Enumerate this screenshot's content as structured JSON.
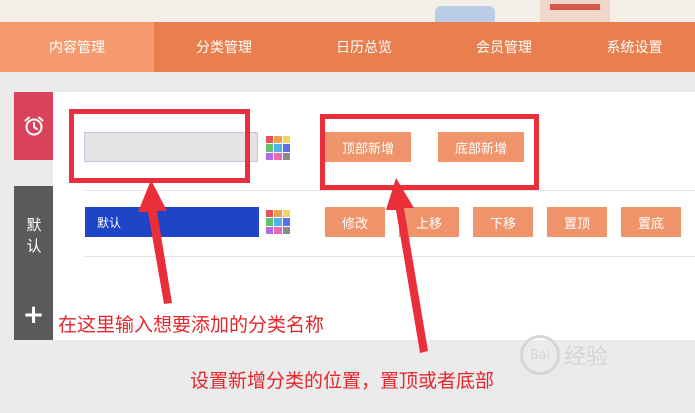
{
  "nav": {
    "tabs": [
      {
        "label": "内容管理",
        "active": true
      },
      {
        "label": "分类管理",
        "active": false
      },
      {
        "label": "日历总览",
        "active": false
      },
      {
        "label": "会员管理",
        "active": false
      },
      {
        "label": "系统设置",
        "active": false
      }
    ]
  },
  "sidebar": {
    "default_label": "默认",
    "add_symbol": "+"
  },
  "form": {
    "name_input_value": "",
    "add_top_label": "顶部新增",
    "add_bottom_label": "底部新增"
  },
  "category_row": {
    "name": "默认",
    "color": "#1e44c8",
    "actions": [
      "修改",
      "上移",
      "下移",
      "置顶",
      "置底"
    ]
  },
  "palette_colors": [
    "#e8505b",
    "#f0a04b",
    "#f6d35c",
    "#60c26a",
    "#4fb3e8",
    "#5c6ee8",
    "#b26ae8",
    "#e86ab2",
    "#8a8a8a"
  ],
  "annotations": {
    "input_note": "在这里输入想要添加的分类名称",
    "position_note": "设置新增分类的位置，置顶或者底部"
  },
  "watermark": {
    "text": "经验"
  },
  "colors": {
    "accent": "#e97f4f",
    "annotation_red": "#ea2f3b"
  }
}
